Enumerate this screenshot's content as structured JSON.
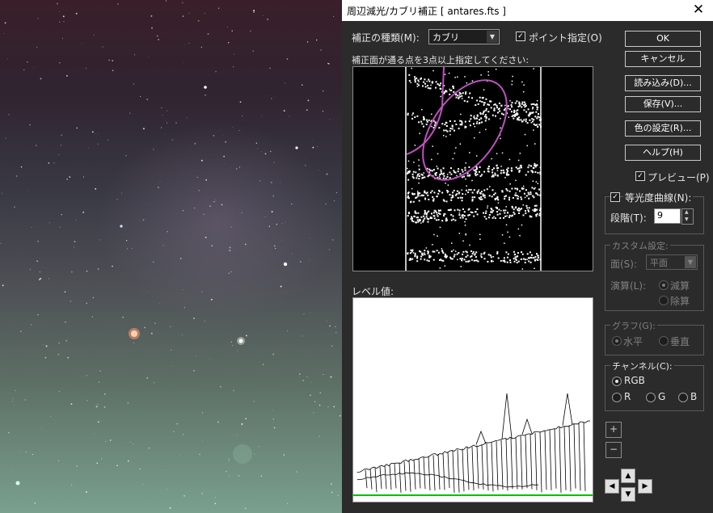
{
  "window": {
    "title": "周辺減光/カブリ補正 [ antares.fts ]"
  },
  "form": {
    "type_label": "補正の種類(M):",
    "type_value": "カブリ",
    "point_label": "ポイント指定(O)",
    "instruction": "補正面が通る点を3点以上指定してください:",
    "level_label": "レベル値:"
  },
  "buttons": {
    "ok": "OK",
    "cancel": "キャンセル",
    "load": "読み込み(D)...",
    "save": "保存(V)...",
    "color": "色の設定(R)...",
    "help": "ヘルプ(H)"
  },
  "preview_label": "プレビュー(P)",
  "isophote": {
    "label": "等光度曲線(N):",
    "steps_label": "段階(T):",
    "steps_value": "9"
  },
  "custom": {
    "title": "カスタム設定:",
    "surface_label": "面(S):",
    "surface_value": "平面",
    "op_label": "演算(L):",
    "subtract": "減算",
    "divide": "除算"
  },
  "graph": {
    "title": "グラフ(G):",
    "horizontal": "水平",
    "vertical": "垂直"
  },
  "channel": {
    "title": "チャンネル(C):",
    "options": [
      "RGB",
      "R",
      "G",
      "B"
    ]
  },
  "zoom": {
    "plus": "+",
    "minus": "−"
  },
  "nav_arrows": {
    "up": "▲",
    "down": "▼",
    "left": "◀",
    "right": "▶"
  },
  "icons": {
    "close": "✕",
    "dropdown": "▼",
    "check": "✓"
  },
  "colors": {
    "background": "#2b2b2b",
    "ellipse": "#c050c0",
    "level_baseline": "#00c000"
  }
}
